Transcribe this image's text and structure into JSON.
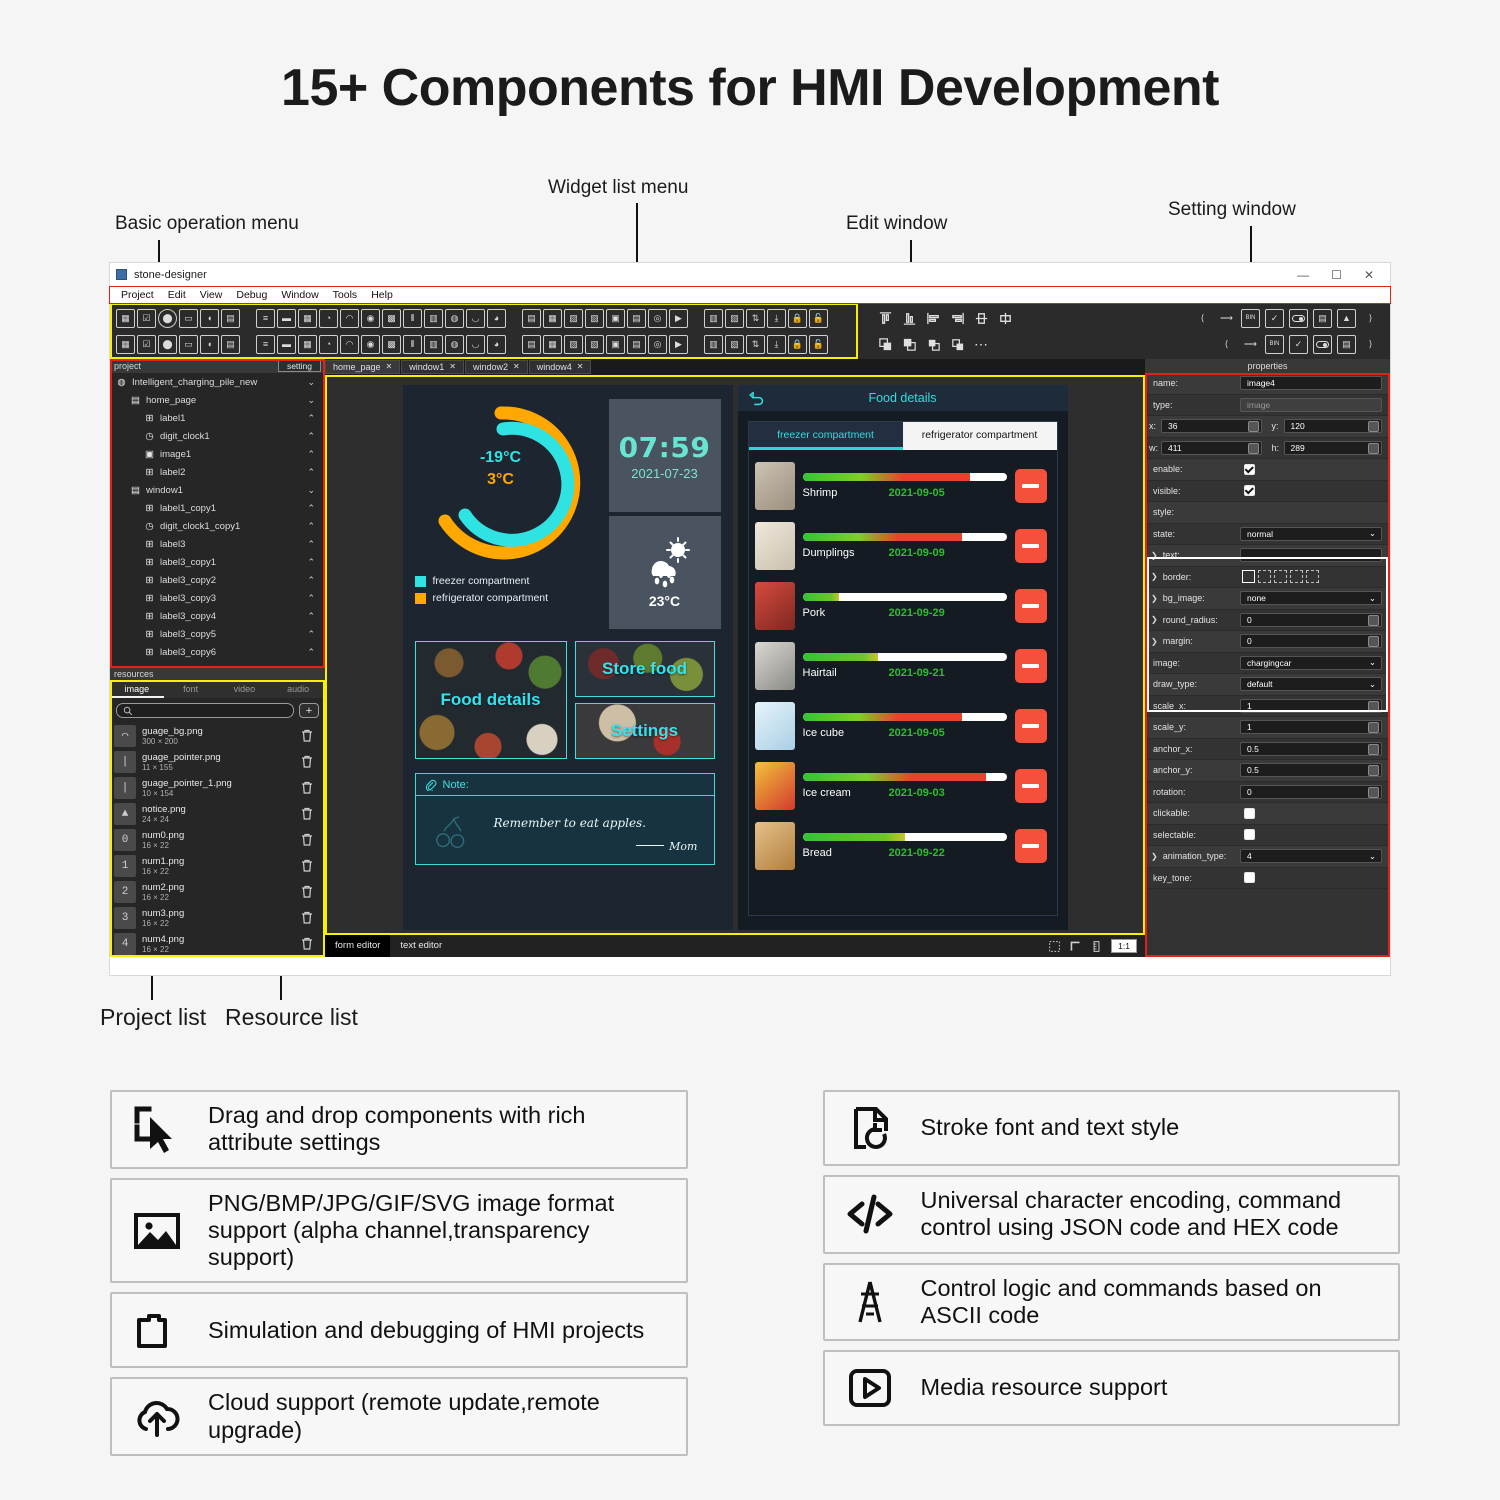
{
  "page_title": "15+ Components for HMI Development",
  "callouts": [
    {
      "id": "basic-operation-menu",
      "label": "Basic operation menu"
    },
    {
      "id": "widget-list-menu",
      "label": "Widget list menu"
    },
    {
      "id": "edit-window",
      "label": "Edit window"
    },
    {
      "id": "setting-window",
      "label": "Setting window"
    },
    {
      "id": "project-list",
      "label": "Project list"
    },
    {
      "id": "resource-list",
      "label": "Resource list"
    }
  ],
  "app": {
    "title": "stone-designer",
    "window_buttons": [
      "minimize",
      "maximize",
      "close"
    ],
    "menu": [
      "Project",
      "Edit",
      "View",
      "Debug",
      "Window",
      "Tools",
      "Help"
    ],
    "toolbar_rows": [
      [
        "bin-icon",
        "checkbox-icon",
        "radio-icon",
        "slider-icon",
        "switch-icon",
        "numeric-icon",
        "equalizer-icon",
        "progress-icon",
        "calendar-icon",
        "clock-icon",
        "gauge-icon",
        "thermometer-icon",
        "qrcode-icon",
        "barcode-icon",
        "chart-icon",
        "circle-gauge-icon",
        "arc-icon",
        "pie-icon",
        "grid-icon",
        "table-icon",
        "image-icon",
        "image-frame-icon",
        "image-list-icon",
        "image-anim-icon",
        "camera-icon",
        "video-icon",
        "gif-icon",
        "screenshot-icon",
        "sliders-icon",
        "download-icon",
        "lock-icon",
        "unlock-icon"
      ],
      [
        "edit-icon",
        "edit2-icon",
        "textbox-icon",
        "font-icon",
        "panel-icon",
        "list-icon",
        "button-icon",
        "menu-icon",
        "draw-icon",
        "label-icon",
        "rotate-icon",
        "pointer-icon",
        "contrast-icon",
        "capsule-icon",
        "window-icon",
        "window-nav-icon",
        "split-icon",
        "monitor-icon",
        "tile-icon",
        "info-icon",
        "columns-icon",
        "listview-icon",
        "vbar-icon",
        "vslider-icon",
        "dialog-icon",
        "popup-icon",
        "grid2-icon",
        "notebook-icon",
        "movepad-icon",
        "bullets-icon",
        "select-icon",
        "brush-icon"
      ]
    ],
    "align_tools": [
      "align-top-icon",
      "align-bottom-icon",
      "align-left-icon",
      "align-right-icon",
      "align-center-v-icon",
      "align-center-h-icon"
    ],
    "group_tools": [
      "group-icon",
      "ungroup-icon",
      "bring-front-icon",
      "send-back-icon",
      "more-icon"
    ],
    "project_panel": {
      "header": "project",
      "setting_button": "setting",
      "tree": [
        {
          "label": "Intelligent_charging_pile_new",
          "level": 1,
          "icon": "project-icon",
          "chevron": "v"
        },
        {
          "label": "home_page",
          "level": 2,
          "icon": "page-icon",
          "chevron": "v"
        },
        {
          "label": "label1",
          "level": 3,
          "icon": "label-icon",
          "chevron": "^"
        },
        {
          "label": "digit_clock1",
          "level": 3,
          "icon": "clock-icon",
          "chevron": "^"
        },
        {
          "label": "image1",
          "level": 3,
          "icon": "image-icon",
          "chevron": "^"
        },
        {
          "label": "label2",
          "level": 3,
          "icon": "label-icon",
          "chevron": "^"
        },
        {
          "label": "window1",
          "level": 2,
          "icon": "page-icon",
          "chevron": "v"
        },
        {
          "label": "label1_copy1",
          "level": 3,
          "icon": "label-icon",
          "chevron": "^"
        },
        {
          "label": "digit_clock1_copy1",
          "level": 3,
          "icon": "clock-icon",
          "chevron": "^"
        },
        {
          "label": "label3",
          "level": 3,
          "icon": "label-icon",
          "chevron": "^"
        },
        {
          "label": "label3_copy1",
          "level": 3,
          "icon": "label-icon",
          "chevron": "^"
        },
        {
          "label": "label3_copy2",
          "level": 3,
          "icon": "label-icon",
          "chevron": "^"
        },
        {
          "label": "label3_copy3",
          "level": 3,
          "icon": "label-icon",
          "chevron": "^"
        },
        {
          "label": "label3_copy4",
          "level": 3,
          "icon": "label-icon",
          "chevron": "^"
        },
        {
          "label": "label3_copy5",
          "level": 3,
          "icon": "label-icon",
          "chevron": "^"
        },
        {
          "label": "label3_copy6",
          "level": 3,
          "icon": "label-icon",
          "chevron": "^"
        }
      ]
    },
    "resources_panel": {
      "header": "resources",
      "tabs": [
        "image",
        "font",
        "video",
        "audio"
      ],
      "active_tab": "image",
      "search_placeholder": "",
      "add_button": "+",
      "items": [
        {
          "name": "guage_bg.png",
          "size": "300 × 200",
          "thumb": "◠"
        },
        {
          "name": "guage_pointer.png",
          "size": "11 × 155",
          "thumb": "|"
        },
        {
          "name": "guage_pointer_1.png",
          "size": "10 × 154",
          "thumb": "|"
        },
        {
          "name": "notice.png",
          "size": "24 × 24",
          "thumb": "▲"
        },
        {
          "name": "num0.png",
          "size": "16 × 22",
          "thumb": "0"
        },
        {
          "name": "num1.png",
          "size": "16 × 22",
          "thumb": "1"
        },
        {
          "name": "num2.png",
          "size": "16 × 22",
          "thumb": "2"
        },
        {
          "name": "num3.png",
          "size": "16 × 22",
          "thumb": "3"
        },
        {
          "name": "num4.png",
          "size": "16 × 22",
          "thumb": "4"
        }
      ]
    },
    "editor_tabs": [
      {
        "label": "home_page",
        "close": "✕",
        "active": true
      },
      {
        "label": "window1",
        "close": "✕",
        "active": false
      },
      {
        "label": "window2",
        "close": "✕",
        "active": false
      },
      {
        "label": "window4",
        "close": "✕",
        "active": false
      }
    ],
    "status_bar": {
      "tabs": [
        "form editor",
        "text editor"
      ],
      "active_tab": "form editor",
      "icons": [
        "select-region-icon",
        "corner-icon",
        "ruler-icon"
      ],
      "zoom": "1:1"
    },
    "properties_panel": {
      "header": "properties",
      "rows": [
        {
          "key": "name:",
          "type": "text",
          "value": "image4"
        },
        {
          "key": "type:",
          "type": "readonly",
          "value": "image"
        },
        {
          "key": "x:",
          "type": "xy",
          "value": "36",
          "key2": "y:",
          "value2": "120"
        },
        {
          "key": "w:",
          "type": "xy",
          "value": "411",
          "key2": "h:",
          "value2": "289"
        },
        {
          "key": "enable:",
          "type": "check",
          "checked": true
        },
        {
          "key": "visible:",
          "type": "check",
          "checked": true
        },
        {
          "key": "style:",
          "type": "blank",
          "value": ""
        },
        {
          "key": "state:",
          "type": "select",
          "value": "normal"
        },
        {
          "key": "text:",
          "type": "text",
          "value": "",
          "expand": true
        },
        {
          "key": "border:",
          "type": "swatches",
          "expand": true
        },
        {
          "key": "bg_image:",
          "type": "select",
          "value": "none",
          "expand": true
        },
        {
          "key": "round_radius:",
          "type": "spin",
          "value": "0",
          "expand": true
        },
        {
          "key": "margin:",
          "type": "spin",
          "value": "0",
          "expand": true
        },
        {
          "key": "image:",
          "type": "select",
          "value": "chargingcar"
        },
        {
          "key": "draw_type:",
          "type": "select",
          "value": "default"
        },
        {
          "key": "scale_x:",
          "type": "spin",
          "value": "1"
        },
        {
          "key": "scale_y:",
          "type": "spin",
          "value": "1"
        },
        {
          "key": "anchor_x:",
          "type": "spin",
          "value": "0.5"
        },
        {
          "key": "anchor_y:",
          "type": "spin",
          "value": "0.5"
        },
        {
          "key": "rotation:",
          "type": "spin",
          "value": "0"
        },
        {
          "key": "clickable:",
          "type": "check",
          "checked": false
        },
        {
          "key": "selectable:",
          "type": "check",
          "checked": false
        },
        {
          "key": "animation_type:",
          "type": "select",
          "value": "4",
          "expand": true
        },
        {
          "key": "key_tone:",
          "type": "check",
          "checked": false
        }
      ]
    }
  },
  "hmi": {
    "home_screen": {
      "gauge": {
        "freezer_temp": "-19°C",
        "fridge_temp": "3°C",
        "freezer_color": "#2fe3e3",
        "fridge_color": "#ffa800"
      },
      "legend": [
        {
          "label": "freezer compartment",
          "color": "#2fe3e3"
        },
        {
          "label": "refrigerator compartment",
          "color": "#ffa800"
        }
      ],
      "clock": {
        "time": "07:59",
        "date": "2021-07-23"
      },
      "weather": {
        "icon": "rain-sun-icon",
        "temp": "23°C"
      },
      "tiles": [
        {
          "label": "Food details",
          "size": "big"
        },
        {
          "label": "Store food",
          "size": "small1"
        },
        {
          "label": "Settings",
          "size": "small2"
        }
      ],
      "note": {
        "header": "Note:",
        "icon": "paperclip-icon",
        "text": "Remember to eat apples.",
        "signature": "Mom",
        "decor_icon": "cherry-icon"
      }
    },
    "food_details_screen": {
      "back_icon": "back-arrow-icon",
      "title": "Food details",
      "tabs": [
        {
          "label": "freezer compartment",
          "active": true
        },
        {
          "label": "refrigerator compartment",
          "active": false
        }
      ],
      "rows": [
        {
          "name": "Shrimp",
          "date": "2021-09-05",
          "percent": 82,
          "thumb": "shrimp-thumb",
          "delete_icon": "minus-icon"
        },
        {
          "name": "Dumplings",
          "date": "2021-09-09",
          "percent": 78,
          "thumb": "dumplings-thumb",
          "delete_icon": "minus-icon"
        },
        {
          "name": "Pork",
          "date": "2021-09-29",
          "percent": 18,
          "thumb": "pork-thumb",
          "delete_icon": "minus-icon"
        },
        {
          "name": "Hairtail",
          "date": "2021-09-21",
          "percent": 37,
          "thumb": "hairtail-thumb",
          "delete_icon": "minus-icon"
        },
        {
          "name": "Ice cube",
          "date": "2021-09-05",
          "percent": 78,
          "thumb": "icecube-thumb",
          "delete_icon": "minus-icon"
        },
        {
          "name": "Ice cream",
          "date": "2021-09-03",
          "percent": 90,
          "thumb": "icecream-thumb",
          "delete_icon": "minus-icon"
        },
        {
          "name": "Bread",
          "date": "2021-09-22",
          "percent": 50,
          "thumb": "bread-thumb",
          "delete_icon": "minus-icon"
        }
      ]
    }
  },
  "features": {
    "left": [
      {
        "icon": "drag-drop-icon",
        "text": "Drag and drop components with rich attribute settings"
      },
      {
        "icon": "image-format-icon",
        "text": "PNG/BMP/JPG/GIF/SVG image format support (alpha channel,transparency support)"
      },
      {
        "icon": "folder-icon",
        "text": "Simulation and debugging of HMI projects"
      },
      {
        "icon": "cloud-upload-icon",
        "text": "Cloud support (remote update,remote upgrade)"
      }
    ],
    "right": [
      {
        "icon": "stroke-font-icon",
        "text": "Stroke font and text style"
      },
      {
        "icon": "code-icon",
        "text": "Universal character encoding, command control using JSON code and HEX code"
      },
      {
        "icon": "ascii-icon",
        "text": "Control logic and commands based on ASCII code"
      },
      {
        "icon": "play-icon",
        "text": "Media resource support"
      }
    ]
  },
  "colors": {
    "highlight_yellow": "#f7f000",
    "highlight_red": "#e32119",
    "highlight_white": "#ffffff",
    "accent_cyan": "#35dcdc",
    "accent_orange": "#ffa800",
    "danger_red": "#f4503c"
  }
}
